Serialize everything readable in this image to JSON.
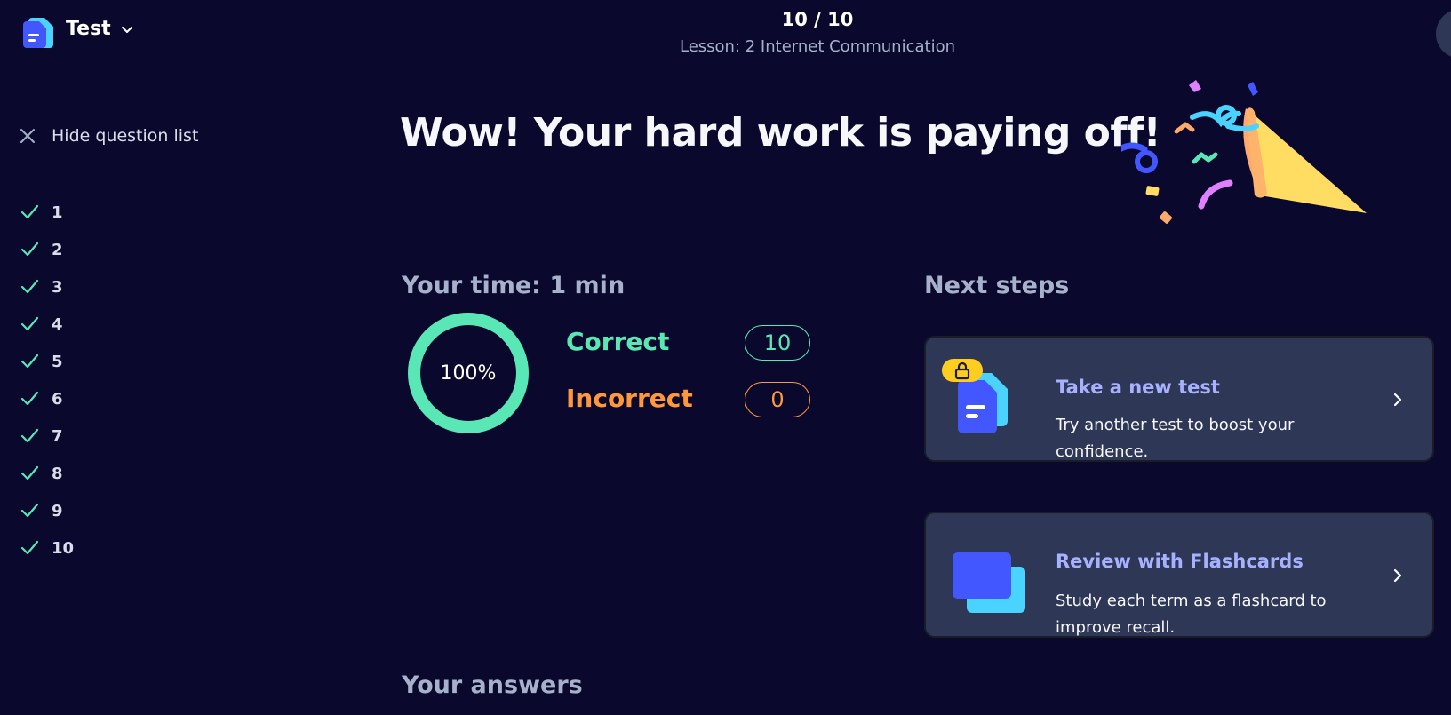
{
  "header": {
    "mode_title": "Test",
    "progress_count": "10 / 10",
    "lesson_title": "Lesson: 2 Internet Communication"
  },
  "sidebar": {
    "hide_label": "Hide question list",
    "questions": [
      {
        "label": "1",
        "status": "correct"
      },
      {
        "label": "2",
        "status": "correct"
      },
      {
        "label": "3",
        "status": "correct"
      },
      {
        "label": "4",
        "status": "correct"
      },
      {
        "label": "5",
        "status": "correct"
      },
      {
        "label": "6",
        "status": "correct"
      },
      {
        "label": "7",
        "status": "correct"
      },
      {
        "label": "8",
        "status": "correct"
      },
      {
        "label": "9",
        "status": "correct"
      },
      {
        "label": "10",
        "status": "correct"
      }
    ]
  },
  "main": {
    "headline": "Wow! Your hard work is paying off!",
    "time_label": "Your time: 1 min",
    "score": {
      "percent_label": "100%",
      "percent_value": 1.0,
      "correct_label": "Correct",
      "correct_count": "10",
      "incorrect_label": "Incorrect",
      "incorrect_count": "0"
    },
    "answers_title": "Your answers"
  },
  "next_steps": {
    "title": "Next steps",
    "cards": [
      {
        "title": "Take a new test",
        "description": "Try another test to boost your confidence.",
        "icon": "locked-test-icon"
      },
      {
        "title": "Review with Flashcards",
        "description": "Study each term as a flashcard to improve recall.",
        "icon": "flashcards-icon"
      }
    ]
  },
  "colors": {
    "background": "#0a092d",
    "correct": "#59e8b5",
    "incorrect": "#ff983a",
    "card_background": "#2e3856",
    "card_title": "#a8b1ff",
    "muted_text": "#a8b1cc"
  }
}
